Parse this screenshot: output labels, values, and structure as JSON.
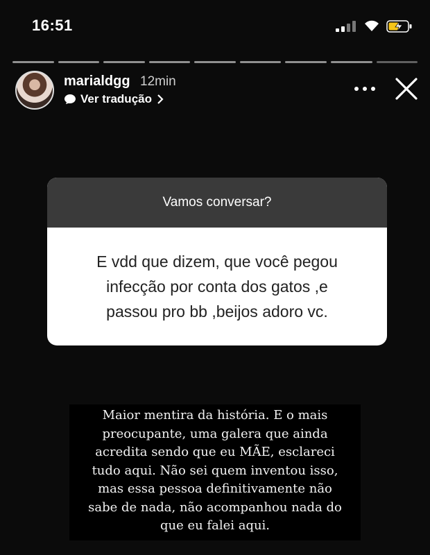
{
  "status": {
    "time": "16:51"
  },
  "story": {
    "username": "marialdgg",
    "time_ago": "12min",
    "translate_label": "Ver tradução",
    "segments": 9
  },
  "question": {
    "header": "Vamos conversar?",
    "lines": [
      "E vdd que dizem, que você pegou",
      "infecção por conta dos gatos ,e",
      "passou pro bb ,beijos adoro vc."
    ]
  },
  "answer": {
    "lines": [
      "Maior mentira da história.  E o mais",
      "preocupante, uma galera que ainda",
      "acredita sendo que eu MÃE, esclareci",
      "tudo aqui. Não sei quem inventou isso,",
      "mas essa pessoa definitivamente não",
      "sabe de nada, não acompanhou nada do",
      "que eu falei aqui."
    ]
  }
}
